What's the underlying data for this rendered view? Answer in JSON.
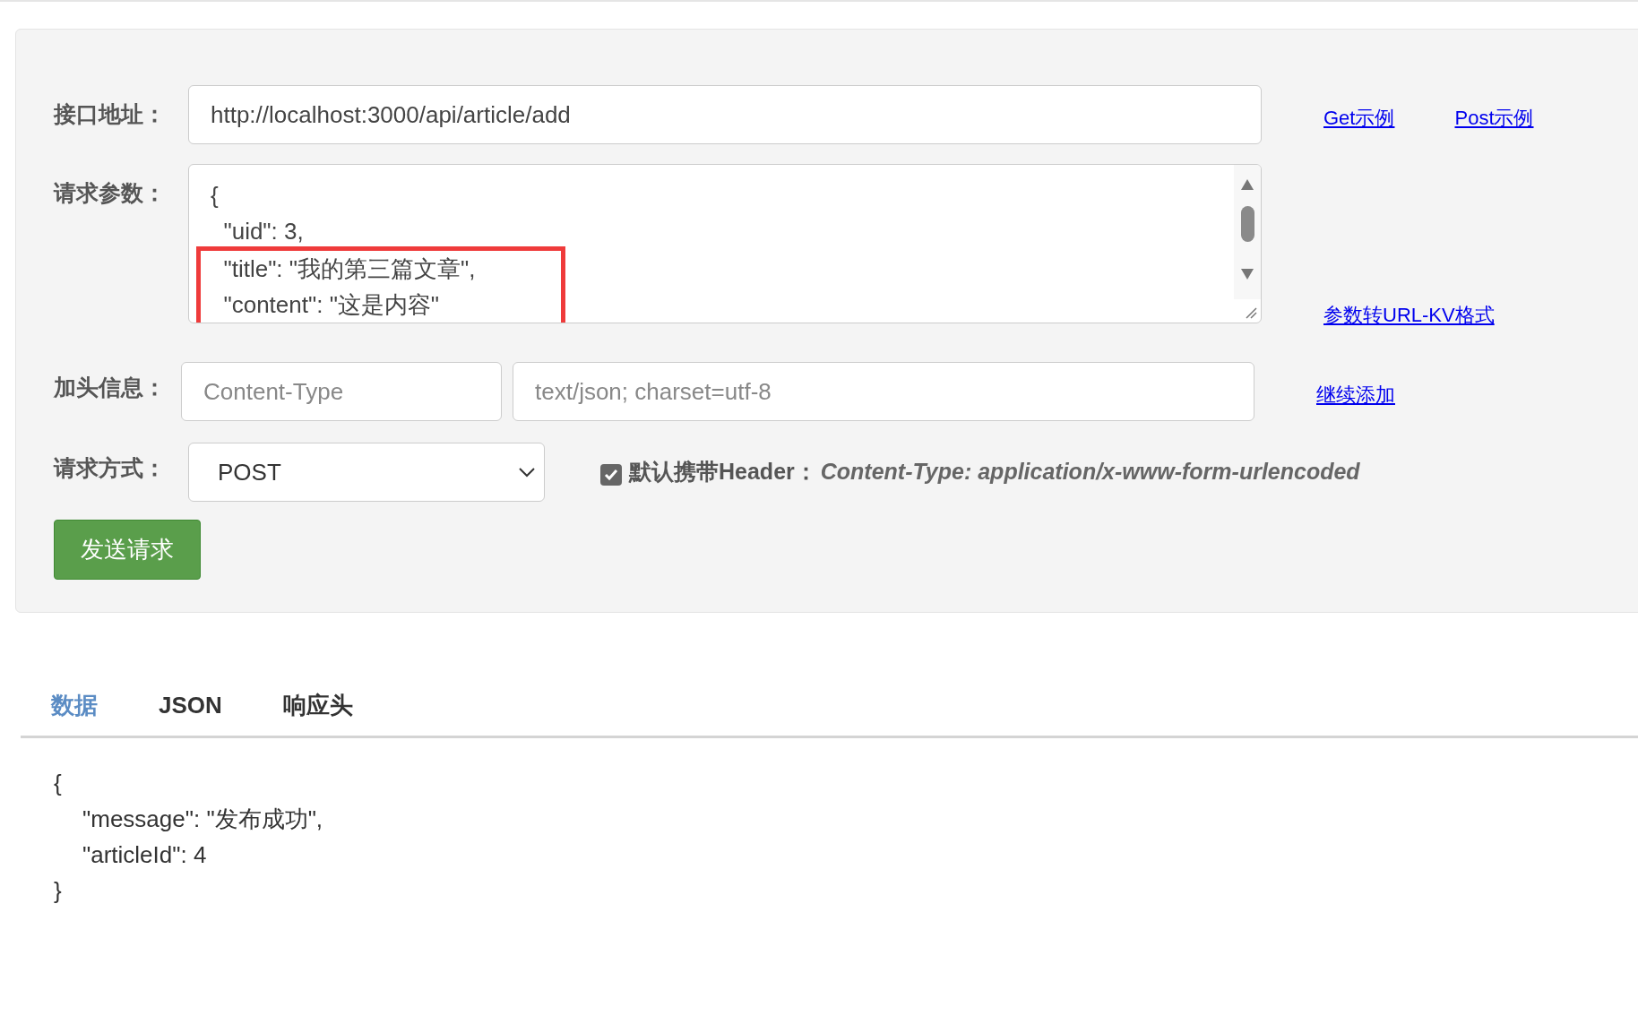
{
  "form": {
    "url_label": "接口地址：",
    "url_value": "http://localhost:3000/api/article/add",
    "links_top": [
      "Get示例",
      "Post示例"
    ],
    "params_label": "请求参数：",
    "params_lines": [
      "{",
      "  \"uid\": 3,"
    ],
    "params_highlighted_lines": [
      "  \"title\": \"我的第三篇文章\",",
      "  \"content\": \"这是内容\""
    ],
    "convert_link": "参数转URL-KV格式",
    "header_label": "加头信息：",
    "header_name_placeholder": "Content-Type",
    "header_value_placeholder": "text/json; charset=utf-8",
    "add_link": "继续添加",
    "method_label": "请求方式：",
    "method_value": "POST",
    "default_header": {
      "checked": true,
      "label": "默认携带Header：",
      "value": "Content-Type: application/x-www-form-urlencoded"
    },
    "send_button": "发送请求"
  },
  "tabs": [
    {
      "label": "数据",
      "selected": true
    },
    {
      "label": "JSON",
      "selected": false
    },
    {
      "label": "响应头",
      "selected": false
    }
  ],
  "response_lines": [
    "{",
    "\"message\": \"发布成功\",",
    "\"articleId\": 4",
    "}"
  ]
}
